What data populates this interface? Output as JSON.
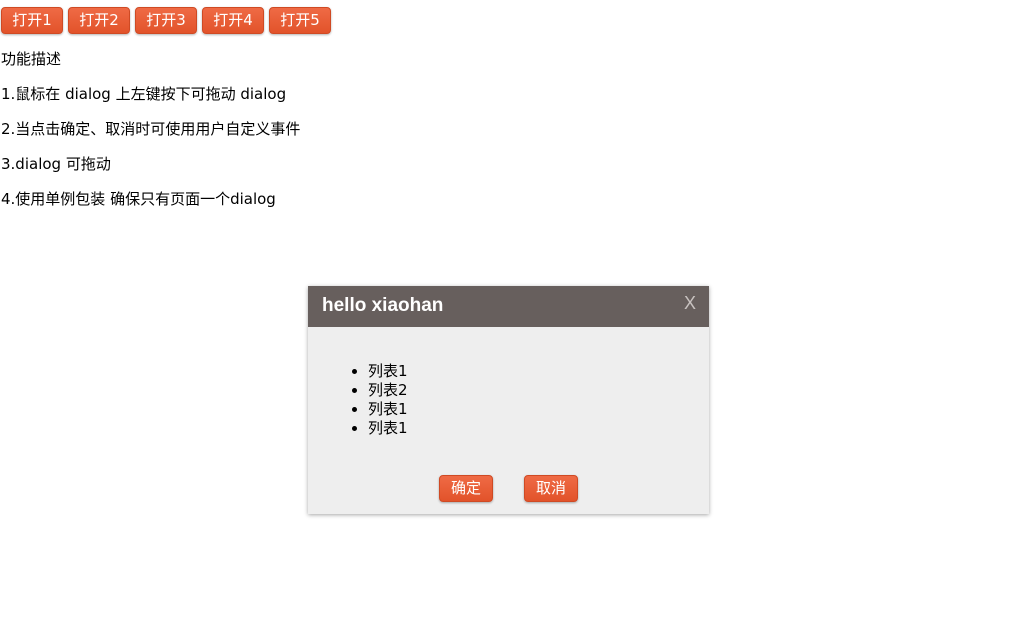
{
  "toolbar": {
    "buttons": [
      "打开1",
      "打开2",
      "打开3",
      "打开4",
      "打开5"
    ]
  },
  "description": {
    "heading": "功能描述",
    "items": [
      "1.鼠标在 dialog 上左键按下可拖动 dialog",
      "2.当点击确定、取消时可使用用户自定义事件",
      "3.dialog 可拖动",
      "4.使用单例包装 确保只有页面一个dialog"
    ]
  },
  "dialog": {
    "title": "hello xiaohan",
    "close_label": "X",
    "list": [
      "列表1",
      "列表2",
      "列表1",
      "列表1"
    ],
    "confirm_label": "确定",
    "cancel_label": "取消"
  },
  "colors": {
    "button_accent": "#e85d35",
    "dialog_header": "#675f5d",
    "dialog_body": "#eeeeee"
  }
}
